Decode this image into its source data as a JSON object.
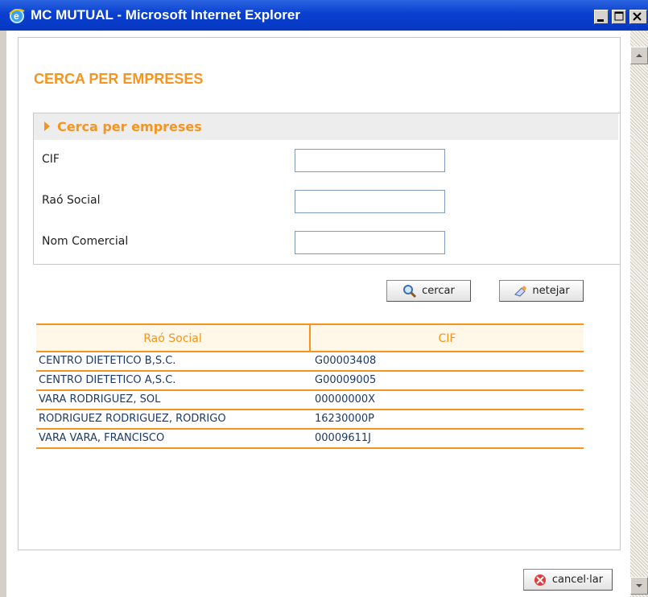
{
  "window": {
    "title": "MC MUTUAL - Microsoft Internet Explorer"
  },
  "page": {
    "title": "CERCA PER EMPRESES"
  },
  "search_section": {
    "header": "Cerca per empreses",
    "fields": [
      {
        "label": "CIF",
        "value": "",
        "placeholder": ""
      },
      {
        "label": "Raó Social",
        "value": "",
        "placeholder": ""
      },
      {
        "label": "Nom Comercial",
        "value": "",
        "placeholder": ""
      }
    ]
  },
  "buttons": {
    "search_label": "cercar",
    "clear_label": "netejar",
    "cancel_label": "cancel·lar"
  },
  "results": {
    "columns": [
      "Raó Social",
      "CIF"
    ],
    "rows": [
      {
        "name": "CENTRO DIETETICO B,S.C.",
        "cif": "G00003408"
      },
      {
        "name": "CENTRO DIETETICO A,S.C.",
        "cif": "G00009005"
      },
      {
        "name": "VARA RODRIGUEZ, SOL",
        "cif": "00000000X"
      },
      {
        "name": "RODRIGUEZ RODRIGUEZ, RODRIGO",
        "cif": "16230000P"
      },
      {
        "name": "VARA VARA, FRANCISCO",
        "cif": "00009611J"
      }
    ]
  },
  "colors": {
    "accent": "#f7941d",
    "titlebar": "#0a3fd0",
    "link_text": "#1c3a6a"
  },
  "icons": [
    "ie-logo-icon",
    "minimize-icon",
    "maximize-icon",
    "close-icon",
    "magnifier-icon",
    "eraser-icon",
    "cancel-icon",
    "scroll-up-icon",
    "scroll-down-icon"
  ]
}
